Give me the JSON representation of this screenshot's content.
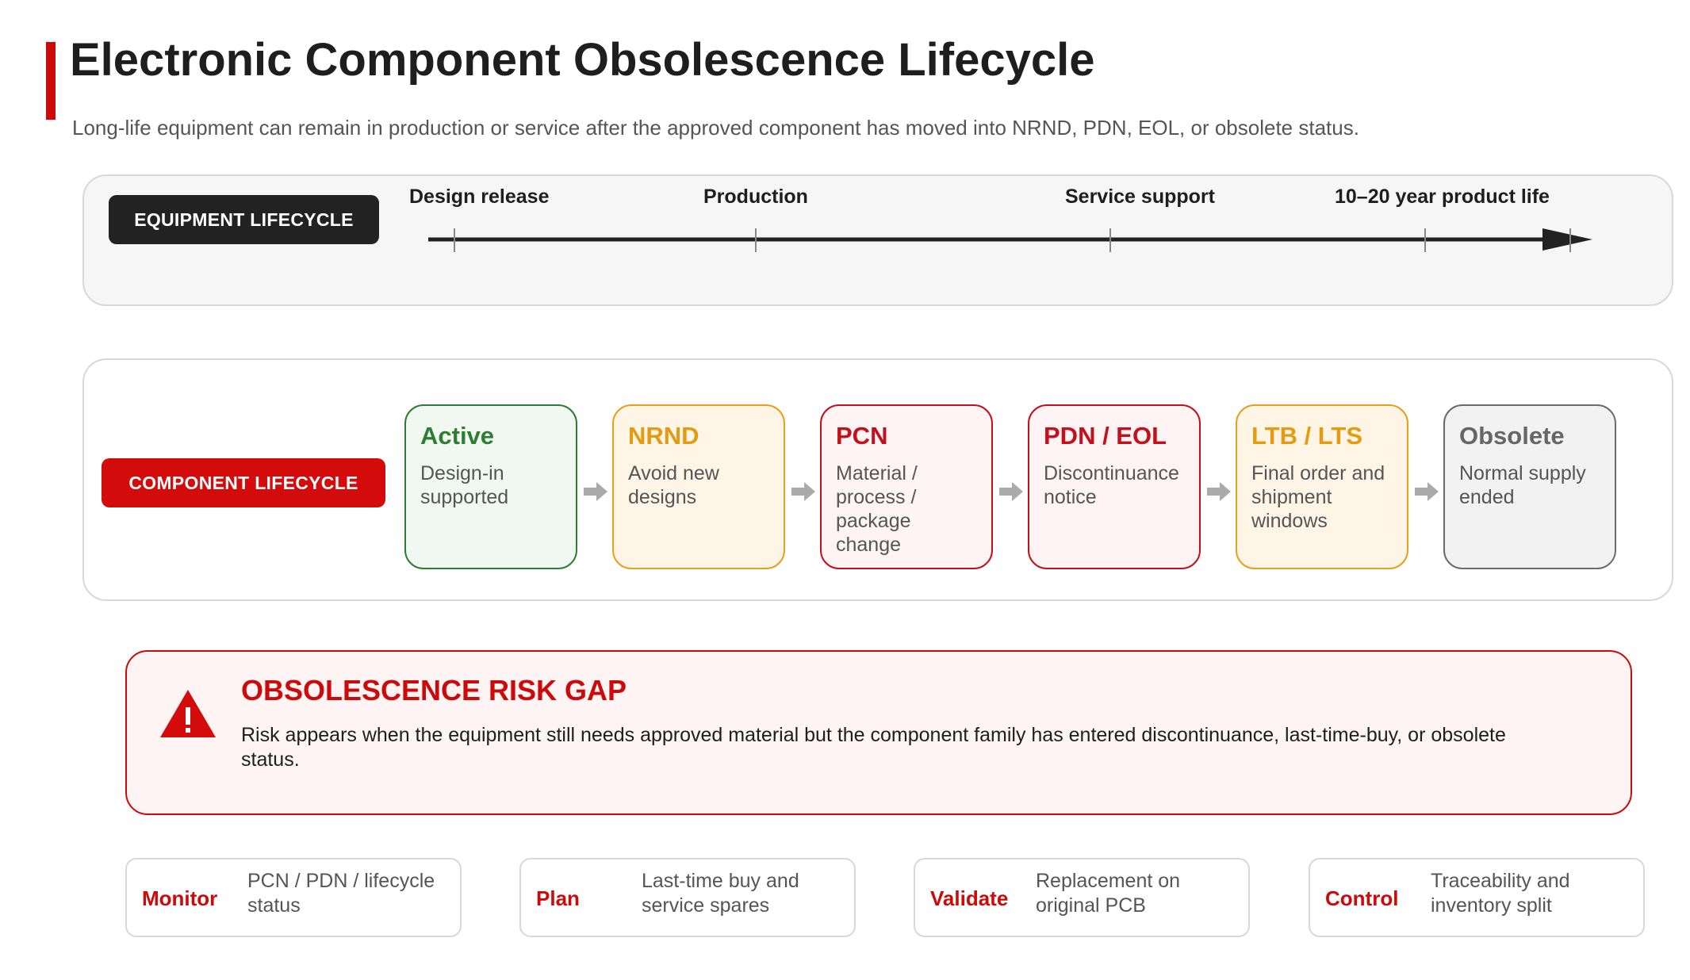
{
  "header": {
    "title": "Electronic Component Obsolescence Lifecycle",
    "subtitle": "Long-life equipment can remain in production or service after the approved component has moved into NRND, PDN, EOL, or obsolete status."
  },
  "equipment": {
    "label": "EQUIPMENT LIFECYCLE",
    "milestones": [
      "Design release",
      "Production",
      "Service support",
      "10–20 year product life"
    ]
  },
  "component": {
    "label": "COMPONENT LIFECYCLE",
    "stages": [
      {
        "title": "Active",
        "desc": "Design-in supported"
      },
      {
        "title": "NRND",
        "desc": "Avoid new designs"
      },
      {
        "title": "PCN",
        "desc": "Material / process / package change"
      },
      {
        "title": "PDN / EOL",
        "desc": "Discontinuance notice"
      },
      {
        "title": "LTB / LTS",
        "desc": "Final order and shipment windows"
      },
      {
        "title": "Obsolete",
        "desc": "Normal supply ended"
      }
    ]
  },
  "risk": {
    "title": "OBSOLESCENCE RISK GAP",
    "text": "Risk appears when the equipment still needs approved material but the component family has entered discontinuance, last-time-buy, or obsolete status.",
    "icon": "warning-triangle-icon"
  },
  "actions": [
    {
      "key": "Monitor",
      "desc": "PCN / PDN / lifecycle status"
    },
    {
      "key": "Plan",
      "desc": "Last-time buy and service spares"
    },
    {
      "key": "Validate",
      "desc": "Replacement on original PCB"
    },
    {
      "key": "Control",
      "desc": "Traceability and inventory split"
    }
  ],
  "colors": {
    "accent_red": "#cc0a0a",
    "active_green": "#2e7d32",
    "nrnd_amber": "#e6a01c",
    "pcn_red": "#c4101c",
    "obsolete_gray": "#666666"
  }
}
